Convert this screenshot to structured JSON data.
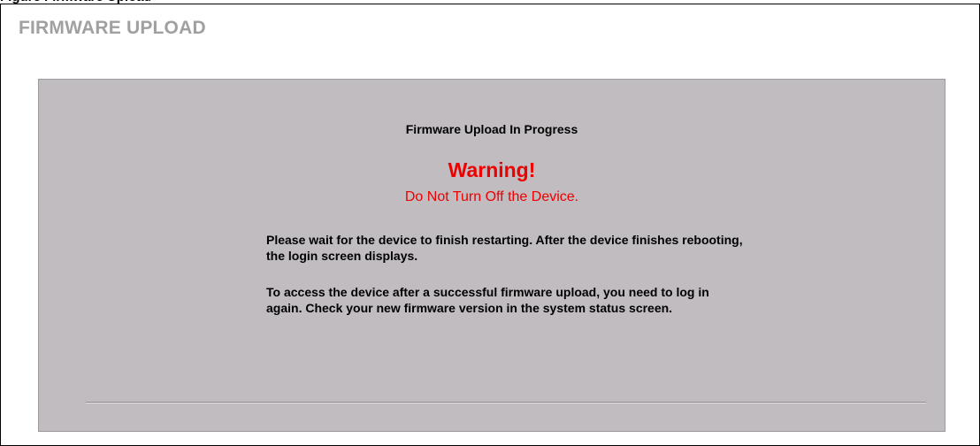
{
  "page": {
    "title": "FIRMWARE UPLOAD"
  },
  "panel": {
    "progress_title": "Firmware Upload In Progress",
    "warning_heading": "Warning!",
    "warning_subtext": "Do Not Turn Off the Device.",
    "message_paragraphs": [
      "Please wait for the device to finish restarting. After the device finishes rebooting, the login screen displays.",
      "To access the device after a successful firmware upload, you need to log in again. Check your new firmware version in the system status screen."
    ]
  },
  "colors": {
    "title_gray": "#a0a0a0",
    "panel_gray": "#c0bcc0",
    "warning_red": "#ee0000"
  }
}
